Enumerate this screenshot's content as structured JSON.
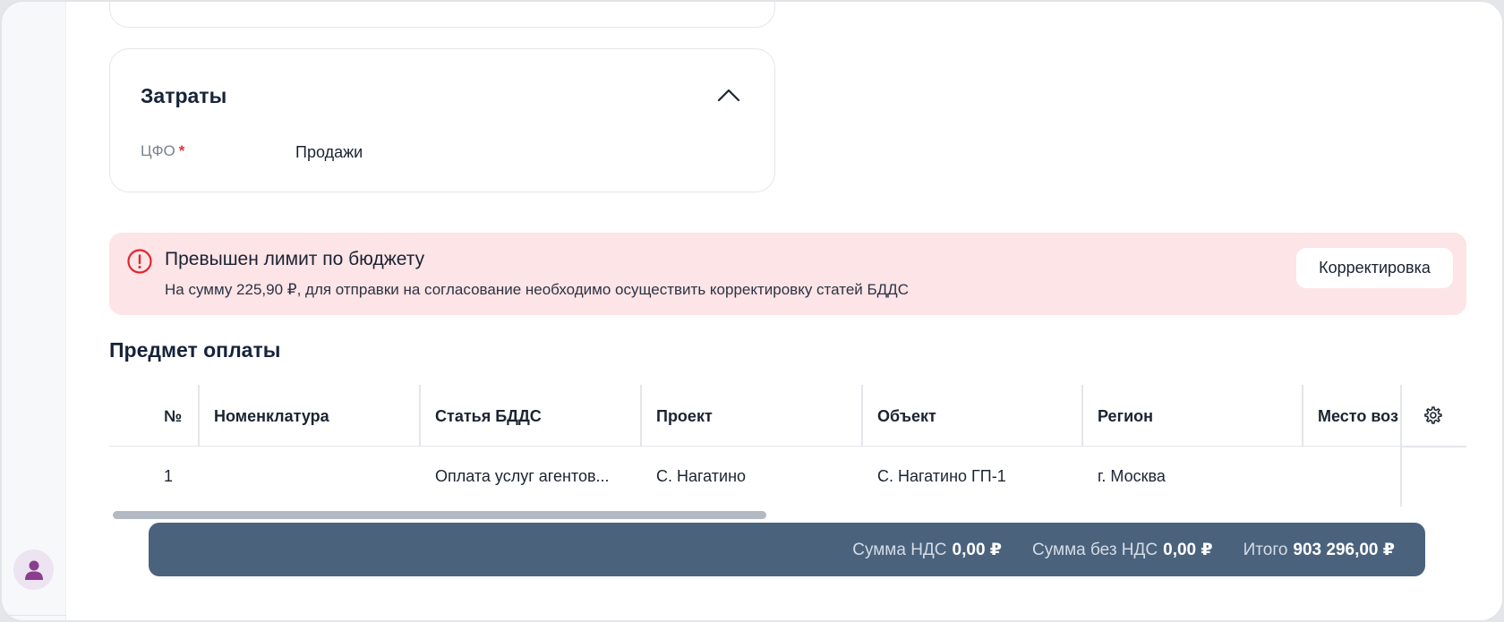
{
  "costs_card": {
    "title": "Затраты",
    "cfo_label": "ЦФО",
    "required_mark": "*",
    "cfo_value": "Продажи"
  },
  "alert": {
    "title": "Превышен лимит по бюджету",
    "text": "На сумму 225,90 ₽, для отправки на согласование необходимо осуществить корректировку статей БДДС",
    "button_label": "Корректировка",
    "color": "#fde4e6",
    "icon": "exclamation-circle-icon"
  },
  "payment_subject": {
    "title": "Предмет оплаты",
    "columns": [
      "№",
      "Номенклатура",
      "Статья БДДС",
      "Проект",
      "Объект",
      "Регион",
      "Место воз"
    ],
    "rows": [
      [
        "1",
        "",
        "Оплата услуг агентов...",
        "С. Нагатино",
        "С. Нагатино ГП-1",
        "г. Москва",
        ""
      ]
    ]
  },
  "totals": {
    "vat_label": "Сумма НДС",
    "vat_value": "0,00 ₽",
    "no_vat_label": "Сумма без НДС",
    "no_vat_value": "0,00 ₽",
    "total_label": "Итого",
    "total_value": "903 296,00 ₽",
    "color": "#4a627c"
  },
  "icons": {
    "avatar": "user-icon",
    "settings": "gear-icon",
    "collapse": "chevron-up-icon"
  }
}
